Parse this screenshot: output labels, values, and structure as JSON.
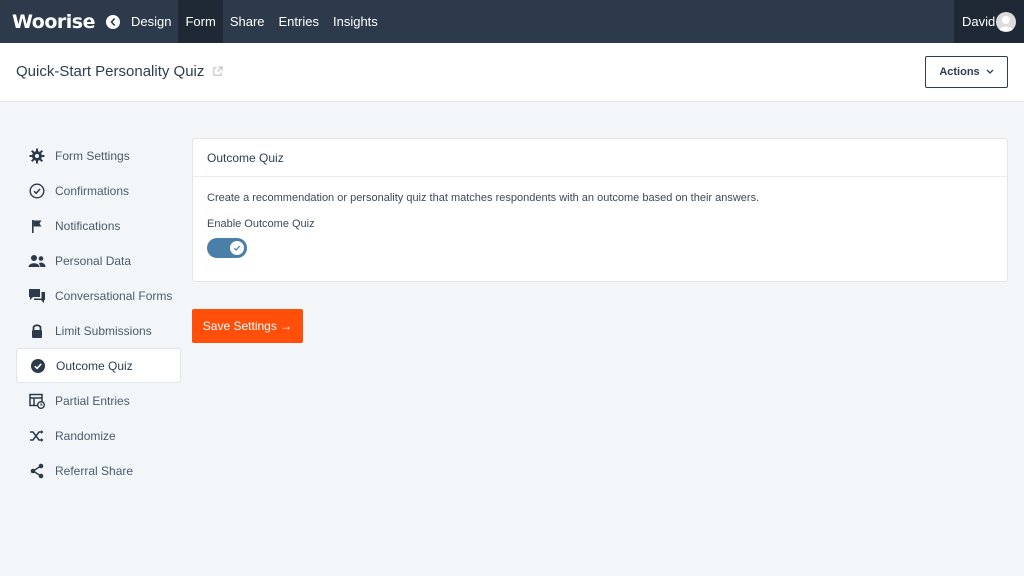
{
  "topnav": {
    "logo": "Woorise",
    "items": [
      {
        "label": "Design",
        "active": false
      },
      {
        "label": "Form",
        "active": true
      },
      {
        "label": "Share",
        "active": false
      },
      {
        "label": "Entries",
        "active": false
      },
      {
        "label": "Insights",
        "active": false
      }
    ],
    "user": "David"
  },
  "header": {
    "title": "Quick-Start Personality Quiz",
    "actions_label": "Actions"
  },
  "sidebar": {
    "items": [
      {
        "label": "Form Settings",
        "icon": "gear-icon"
      },
      {
        "label": "Confirmations",
        "icon": "check-circle-icon"
      },
      {
        "label": "Notifications",
        "icon": "flag-icon"
      },
      {
        "label": "Personal Data",
        "icon": "users-icon"
      },
      {
        "label": "Conversational Forms",
        "icon": "chat-icon"
      },
      {
        "label": "Limit Submissions",
        "icon": "lock-icon"
      },
      {
        "label": "Outcome Quiz",
        "icon": "check-filled-icon",
        "active": true
      },
      {
        "label": "Partial Entries",
        "icon": "table-icon"
      },
      {
        "label": "Randomize",
        "icon": "shuffle-icon"
      },
      {
        "label": "Referral Share",
        "icon": "share-icon"
      }
    ]
  },
  "card": {
    "title": "Outcome Quiz",
    "description": "Create a recommendation or personality quiz that matches respondents with an outcome based on their answers.",
    "field_label": "Enable Outcome Quiz",
    "toggle_on": true
  },
  "save_label": "Save Settings →",
  "colors": {
    "nav_bg": "#2c3a4b",
    "accent": "#ff4f0b",
    "toggle": "#4a7fa7"
  }
}
